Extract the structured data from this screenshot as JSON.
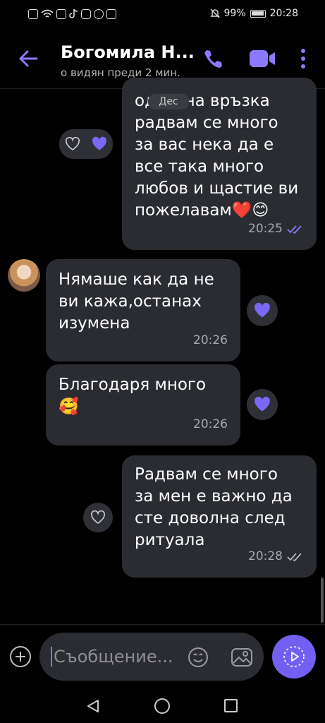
{
  "status": {
    "battery": "99%",
    "time": "20:28"
  },
  "header": {
    "title": "Богомила Н...",
    "subtitle": "о видян преди 2 мин.",
    "accent": "#7360f2"
  },
  "messages": [
    {
      "id": "m1",
      "direction": "outgoing",
      "quote_label": "Дес",
      "text": "одрстна връзка\nрадвам се много\nза вас нека да е\nвсе така много\nлюбов и щастие ви\nпожелавам❤️😊",
      "time": "20:25",
      "status_icon": "double-check-icon",
      "reactions": [
        "heart-outline-icon",
        "heart-filled-icon"
      ]
    },
    {
      "id": "m2",
      "direction": "incoming",
      "text": "Нямаше как да не\nви кажа,останах\nизумена",
      "time": "20:26",
      "reaction": "heart-filled-icon"
    },
    {
      "id": "m3",
      "direction": "incoming",
      "text": "Благодаря много\n🥰",
      "time": "20:26",
      "reaction": "heart-filled-icon"
    },
    {
      "id": "m4",
      "direction": "outgoing",
      "text": "Радвам се много\nза мен е важно да\nсте доволна след\nритуала",
      "time": "20:28",
      "status_icon": "double-check-icon",
      "reaction": "heart-outline-icon"
    }
  ],
  "composer": {
    "placeholder": "Съобщение..."
  }
}
